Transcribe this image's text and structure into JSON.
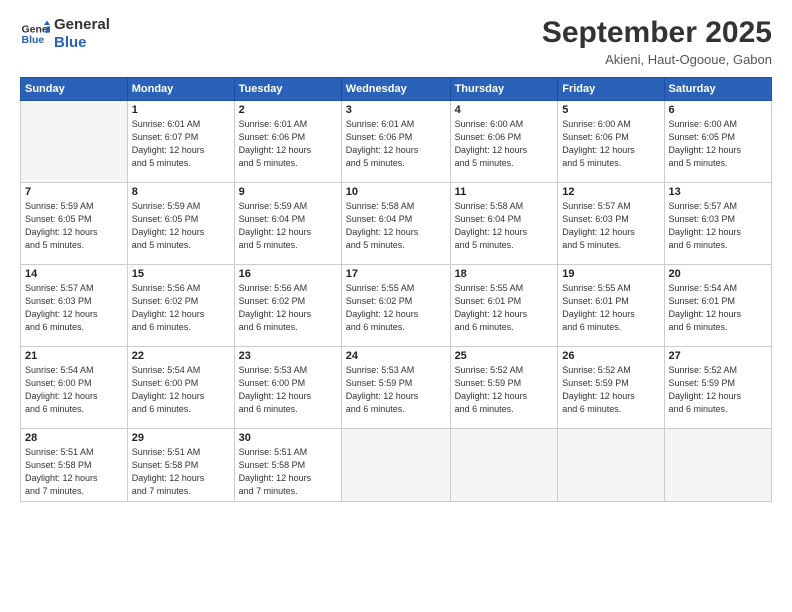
{
  "logo": {
    "line1": "General",
    "line2": "Blue"
  },
  "title": "September 2025",
  "subtitle": "Akieni, Haut-Ogooue, Gabon",
  "days_header": [
    "Sunday",
    "Monday",
    "Tuesday",
    "Wednesday",
    "Thursday",
    "Friday",
    "Saturday"
  ],
  "weeks": [
    [
      {
        "num": "",
        "info": ""
      },
      {
        "num": "1",
        "info": "Sunrise: 6:01 AM\nSunset: 6:07 PM\nDaylight: 12 hours\nand 5 minutes."
      },
      {
        "num": "2",
        "info": "Sunrise: 6:01 AM\nSunset: 6:06 PM\nDaylight: 12 hours\nand 5 minutes."
      },
      {
        "num": "3",
        "info": "Sunrise: 6:01 AM\nSunset: 6:06 PM\nDaylight: 12 hours\nand 5 minutes."
      },
      {
        "num": "4",
        "info": "Sunrise: 6:00 AM\nSunset: 6:06 PM\nDaylight: 12 hours\nand 5 minutes."
      },
      {
        "num": "5",
        "info": "Sunrise: 6:00 AM\nSunset: 6:06 PM\nDaylight: 12 hours\nand 5 minutes."
      },
      {
        "num": "6",
        "info": "Sunrise: 6:00 AM\nSunset: 6:05 PM\nDaylight: 12 hours\nand 5 minutes."
      }
    ],
    [
      {
        "num": "7",
        "info": "Sunrise: 5:59 AM\nSunset: 6:05 PM\nDaylight: 12 hours\nand 5 minutes."
      },
      {
        "num": "8",
        "info": "Sunrise: 5:59 AM\nSunset: 6:05 PM\nDaylight: 12 hours\nand 5 minutes."
      },
      {
        "num": "9",
        "info": "Sunrise: 5:59 AM\nSunset: 6:04 PM\nDaylight: 12 hours\nand 5 minutes."
      },
      {
        "num": "10",
        "info": "Sunrise: 5:58 AM\nSunset: 6:04 PM\nDaylight: 12 hours\nand 5 minutes."
      },
      {
        "num": "11",
        "info": "Sunrise: 5:58 AM\nSunset: 6:04 PM\nDaylight: 12 hours\nand 5 minutes."
      },
      {
        "num": "12",
        "info": "Sunrise: 5:57 AM\nSunset: 6:03 PM\nDaylight: 12 hours\nand 5 minutes."
      },
      {
        "num": "13",
        "info": "Sunrise: 5:57 AM\nSunset: 6:03 PM\nDaylight: 12 hours\nand 6 minutes."
      }
    ],
    [
      {
        "num": "14",
        "info": "Sunrise: 5:57 AM\nSunset: 6:03 PM\nDaylight: 12 hours\nand 6 minutes."
      },
      {
        "num": "15",
        "info": "Sunrise: 5:56 AM\nSunset: 6:02 PM\nDaylight: 12 hours\nand 6 minutes."
      },
      {
        "num": "16",
        "info": "Sunrise: 5:56 AM\nSunset: 6:02 PM\nDaylight: 12 hours\nand 6 minutes."
      },
      {
        "num": "17",
        "info": "Sunrise: 5:55 AM\nSunset: 6:02 PM\nDaylight: 12 hours\nand 6 minutes."
      },
      {
        "num": "18",
        "info": "Sunrise: 5:55 AM\nSunset: 6:01 PM\nDaylight: 12 hours\nand 6 minutes."
      },
      {
        "num": "19",
        "info": "Sunrise: 5:55 AM\nSunset: 6:01 PM\nDaylight: 12 hours\nand 6 minutes."
      },
      {
        "num": "20",
        "info": "Sunrise: 5:54 AM\nSunset: 6:01 PM\nDaylight: 12 hours\nand 6 minutes."
      }
    ],
    [
      {
        "num": "21",
        "info": "Sunrise: 5:54 AM\nSunset: 6:00 PM\nDaylight: 12 hours\nand 6 minutes."
      },
      {
        "num": "22",
        "info": "Sunrise: 5:54 AM\nSunset: 6:00 PM\nDaylight: 12 hours\nand 6 minutes."
      },
      {
        "num": "23",
        "info": "Sunrise: 5:53 AM\nSunset: 6:00 PM\nDaylight: 12 hours\nand 6 minutes."
      },
      {
        "num": "24",
        "info": "Sunrise: 5:53 AM\nSunset: 5:59 PM\nDaylight: 12 hours\nand 6 minutes."
      },
      {
        "num": "25",
        "info": "Sunrise: 5:52 AM\nSunset: 5:59 PM\nDaylight: 12 hours\nand 6 minutes."
      },
      {
        "num": "26",
        "info": "Sunrise: 5:52 AM\nSunset: 5:59 PM\nDaylight: 12 hours\nand 6 minutes."
      },
      {
        "num": "27",
        "info": "Sunrise: 5:52 AM\nSunset: 5:59 PM\nDaylight: 12 hours\nand 6 minutes."
      }
    ],
    [
      {
        "num": "28",
        "info": "Sunrise: 5:51 AM\nSunset: 5:58 PM\nDaylight: 12 hours\nand 7 minutes."
      },
      {
        "num": "29",
        "info": "Sunrise: 5:51 AM\nSunset: 5:58 PM\nDaylight: 12 hours\nand 7 minutes."
      },
      {
        "num": "30",
        "info": "Sunrise: 5:51 AM\nSunset: 5:58 PM\nDaylight: 12 hours\nand 7 minutes."
      },
      {
        "num": "",
        "info": ""
      },
      {
        "num": "",
        "info": ""
      },
      {
        "num": "",
        "info": ""
      },
      {
        "num": "",
        "info": ""
      }
    ]
  ]
}
